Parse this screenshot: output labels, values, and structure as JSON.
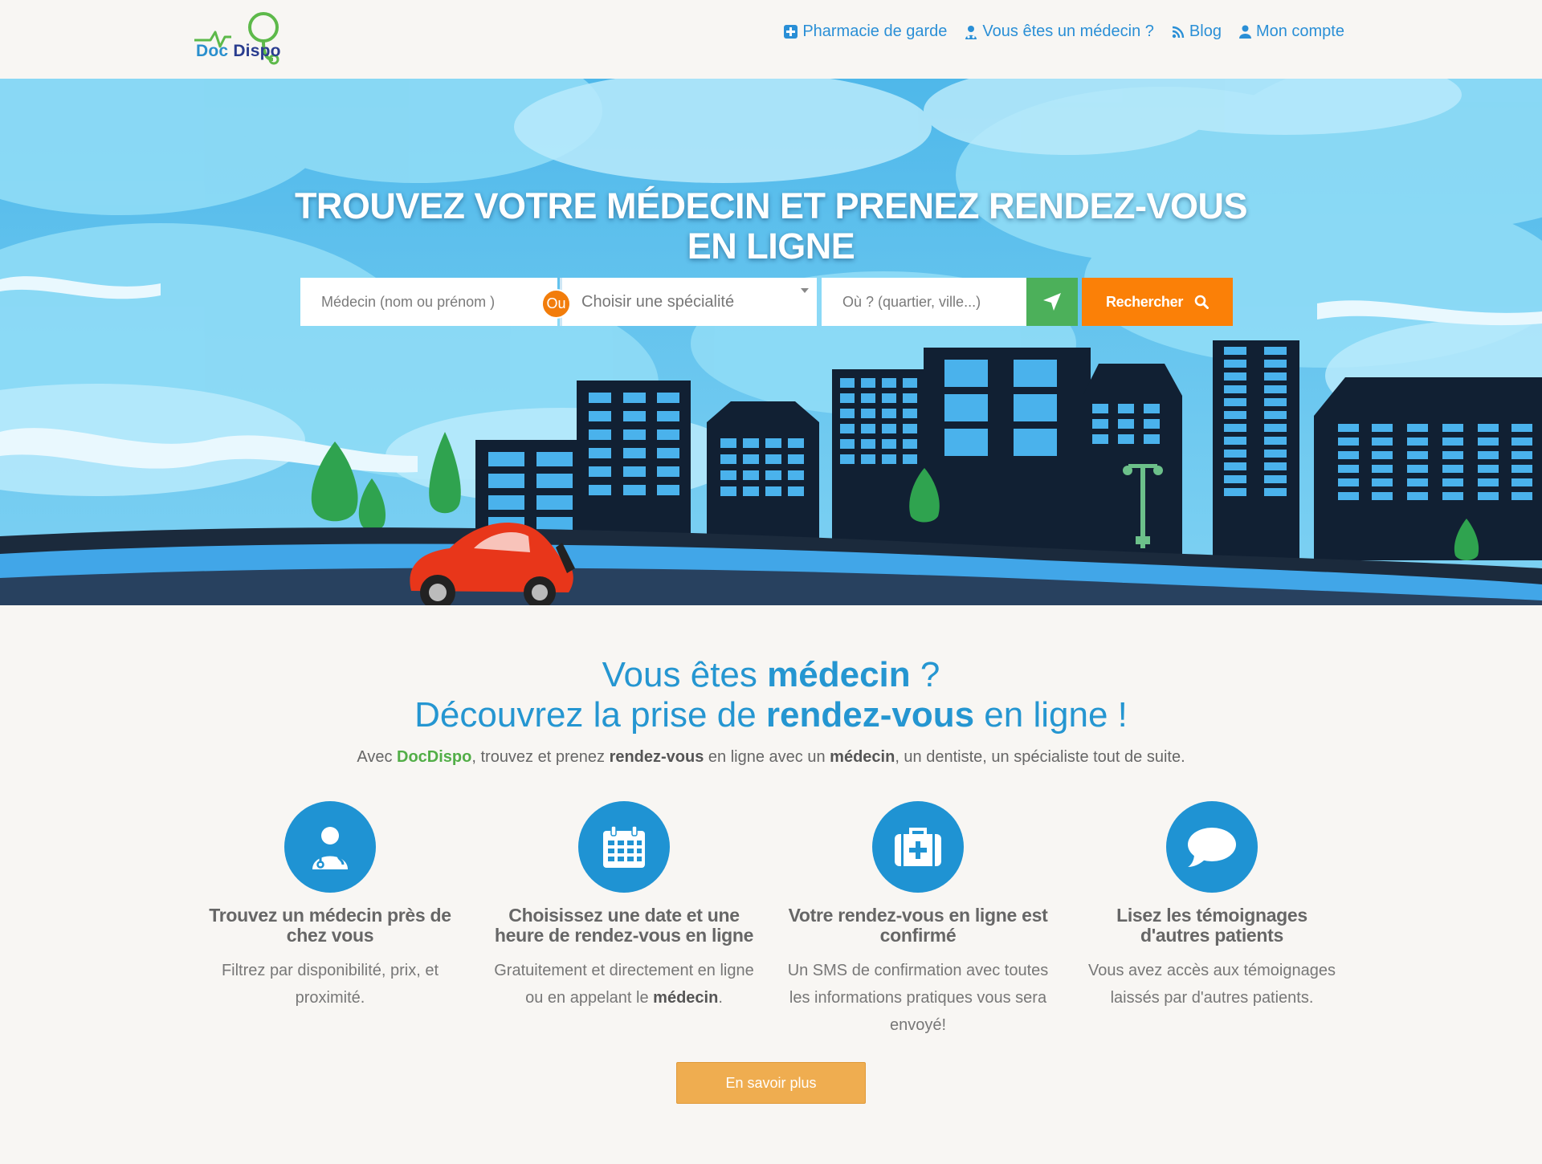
{
  "header": {
    "logo": {
      "part1": "Doc ",
      "part2": "Dispo"
    },
    "nav": [
      {
        "label": "Pharmacie de garde",
        "icon": "plus-square-icon"
      },
      {
        "label": "Vous êtes un médecin ?",
        "icon": "doctor-icon"
      },
      {
        "label": "Blog",
        "icon": "rss-icon"
      },
      {
        "label": "Mon compte",
        "icon": "user-icon"
      }
    ]
  },
  "hero": {
    "title": "TROUVEZ VOTRE MÉDECIN ET PRENEZ RENDEZ-VOUS EN LIGNE",
    "search": {
      "doctor_placeholder": "Médecin (nom ou prénom )",
      "or_label": "Ou",
      "specialty_value": "Choisir une spécialité",
      "where_placeholder": "Où ? (quartier, ville...)",
      "search_label": "Rechercher"
    }
  },
  "intro": {
    "h1_a": "Vous êtes ",
    "h1_b": "médecin",
    "h1_c": " ?",
    "h2_a": "Découvrez la prise de ",
    "h2_b": "rendez-vous",
    "h2_c": " en ligne !",
    "p_a": "Avec ",
    "p_brand": "DocDispo",
    "p_b": ", trouvez et prenez ",
    "p_c": "rendez-vous",
    "p_d": " en ligne avec un ",
    "p_e": "médecin",
    "p_f": ", un dentiste, un spécialiste tout de suite."
  },
  "features": [
    {
      "title": "Trouvez un médecin près de chez vous",
      "desc": "Filtrez par disponibilité, prix, et proximité.",
      "icon": "doctor-icon"
    },
    {
      "title": "Choisissez une date et une heure de rendez-vous en ligne",
      "desc_a": "Gratuitement et directement en ligne ou en appelant le ",
      "desc_b": "médecin",
      "desc_c": ".",
      "icon": "calendar-icon"
    },
    {
      "title": "Votre rendez-vous en ligne est confirmé",
      "desc": "Un SMS de confirmation avec toutes les informations pratiques vous sera envoyé!",
      "icon": "medkit-icon"
    },
    {
      "title": "Lisez les témoignages d'autres patients",
      "desc": "Vous avez accès aux témoignages laissés par d'autres patients.",
      "icon": "comment-icon"
    }
  ],
  "more_button": "En savoir plus",
  "colors": {
    "primary": "#1f93d3",
    "orange": "#fb8007",
    "green": "#4cb05a",
    "button": "#efad50",
    "brand_green": "#52ae47"
  }
}
